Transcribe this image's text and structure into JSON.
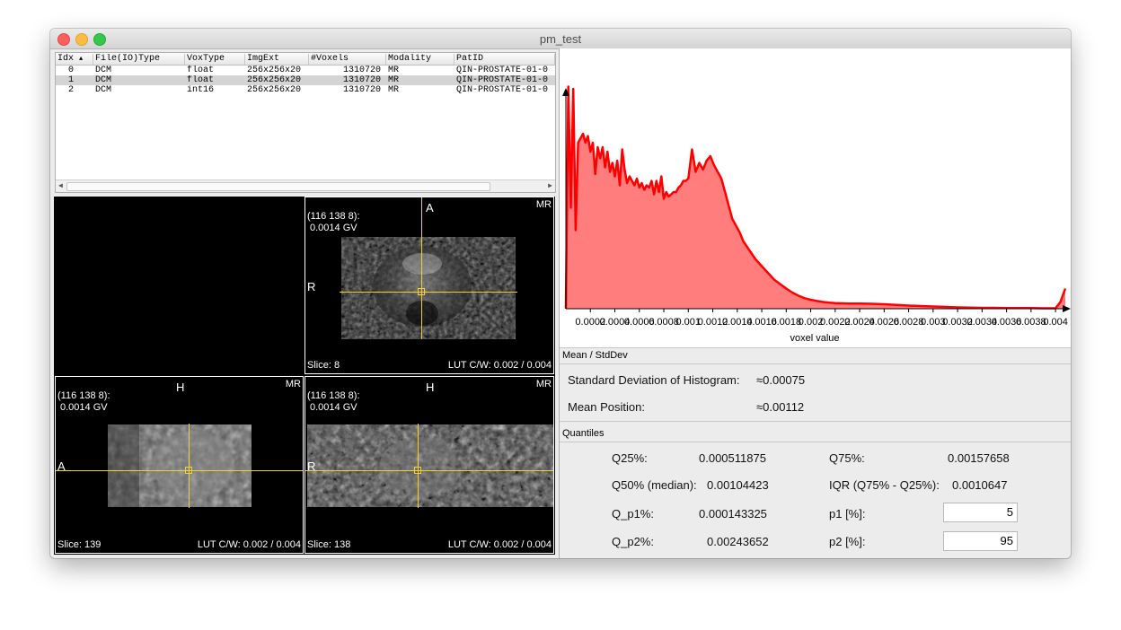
{
  "window": {
    "title": "pm_test"
  },
  "table": {
    "columns": [
      "Idx",
      "File(IO)Type",
      "VoxType",
      "ImgExt",
      "#Voxels",
      "Modality",
      "PatID"
    ],
    "rows": [
      [
        "0",
        "DCM",
        "float",
        "256x256x20",
        "1310720",
        "MR",
        "QIN-PROSTATE-01-0"
      ],
      [
        "1",
        "DCM",
        "float",
        "256x256x20",
        "1310720",
        "MR",
        "QIN-PROSTATE-01-0"
      ],
      [
        "2",
        "DCM",
        "int16",
        "256x256x20",
        "1310720",
        "MR",
        "QIN-PROSTATE-01-0"
      ]
    ],
    "selected_row": 1,
    "sort_indicator": "▲"
  },
  "viewers": {
    "axial": {
      "coords": "(116 138 8):",
      "value": "0.0014 GV",
      "top_label": "A",
      "left_label": "R",
      "modality": "MR",
      "slice": "Slice: 8",
      "lut": "LUT C/W: 0.002 / 0.004"
    },
    "sagittal": {
      "coords": "(116 138 8):",
      "value": "0.0014 GV",
      "top_label": "H",
      "left_label": "A",
      "modality": "MR",
      "slice": "Slice: 139",
      "lut": "LUT C/W: 0.002 / 0.004"
    },
    "coronal": {
      "coords": "(116 138 8):",
      "value": "0.0014 GV",
      "top_label": "H",
      "left_label": "R",
      "modality": "MR",
      "slice": "Slice: 138",
      "lut": "LUT C/W: 0.002 / 0.004"
    }
  },
  "chart_data": {
    "type": "area",
    "title": "",
    "xlabel": "voxel value",
    "ylabel": "",
    "xlim": [
      0,
      0.0041
    ],
    "tick_labels": [
      "0.0002",
      "0.0004",
      "0.0006",
      "0.0008",
      "0.001",
      "0.0012",
      "0.0014",
      "0.0016",
      "0.0018",
      "0.002",
      "0.0022",
      "0.0024",
      "0.0026",
      "0.0028",
      "0.003",
      "0.0032",
      "0.0034",
      "0.0036",
      "0.0038",
      "0.004"
    ],
    "tick_values": [
      0.0002,
      0.0004,
      0.0006,
      0.0008,
      0.001,
      0.0012,
      0.0014,
      0.0016,
      0.0018,
      0.002,
      0.0022,
      0.0024,
      0.0026,
      0.0028,
      0.003,
      0.0032,
      0.0034,
      0.0036,
      0.0038,
      0.004
    ],
    "x": [
      0,
      2e-05,
      4e-05,
      6e-05,
      8e-05,
      0.0001,
      0.00012,
      0.00014,
      0.00016,
      0.00018,
      0.0002,
      0.00022,
      0.00024,
      0.00026,
      0.00028,
      0.0003,
      0.00032,
      0.00034,
      0.00036,
      0.00038,
      0.0004,
      0.00042,
      0.00044,
      0.00046,
      0.00048,
      0.0005,
      0.00052,
      0.00054,
      0.00056,
      0.00058,
      0.0006,
      0.00062,
      0.00064,
      0.00066,
      0.00068,
      0.0007,
      0.00072,
      0.00074,
      0.00076,
      0.00078,
      0.0008,
      0.00082,
      0.00084,
      0.00086,
      0.00088,
      0.0009,
      0.00092,
      0.00094,
      0.00096,
      0.00098,
      0.001,
      0.00103,
      0.00106,
      0.00109,
      0.00112,
      0.00115,
      0.00118,
      0.00121,
      0.00124,
      0.00127,
      0.0013,
      0.00133,
      0.00136,
      0.00139,
      0.00142,
      0.00145,
      0.0015,
      0.00155,
      0.0016,
      0.00165,
      0.0017,
      0.00175,
      0.0018,
      0.00185,
      0.0019,
      0.00195,
      0.002,
      0.00205,
      0.0021,
      0.00215,
      0.0022,
      0.00225,
      0.0023,
      0.00235,
      0.0024,
      0.0025,
      0.0026,
      0.0027,
      0.0028,
      0.0029,
      0.003,
      0.0031,
      0.0032,
      0.0033,
      0.0034,
      0.0035,
      0.0036,
      0.0037,
      0.0038,
      0.0039,
      0.004,
      0.00404,
      0.00408
    ],
    "values": [
      0,
      0.99,
      0.45,
      0.98,
      0.35,
      0.74,
      0.76,
      0.78,
      0.74,
      0.77,
      0.7,
      0.74,
      0.6,
      0.72,
      0.67,
      0.72,
      0.63,
      0.7,
      0.61,
      0.65,
      0.59,
      0.66,
      0.55,
      0.71,
      0.62,
      0.56,
      0.59,
      0.57,
      0.55,
      0.58,
      0.54,
      0.56,
      0.53,
      0.55,
      0.54,
      0.57,
      0.51,
      0.57,
      0.52,
      0.59,
      0.49,
      0.52,
      0.5,
      0.51,
      0.52,
      0.52,
      0.54,
      0.55,
      0.57,
      0.57,
      0.58,
      0.71,
      0.61,
      0.65,
      0.62,
      0.66,
      0.68,
      0.64,
      0.61,
      0.58,
      0.52,
      0.46,
      0.4,
      0.37,
      0.34,
      0.3,
      0.26,
      0.22,
      0.19,
      0.16,
      0.13,
      0.11,
      0.09,
      0.072,
      0.058,
      0.047,
      0.04,
      0.035,
      0.03,
      0.027,
      0.025,
      0.024,
      0.023,
      0.023,
      0.023,
      0.022,
      0.02,
      0.017,
      0.014,
      0.012,
      0.01,
      0.008,
      0.006,
      0.005,
      0.004,
      0.004,
      0.003,
      0.003,
      0.003,
      0.002,
      0.002,
      0.03,
      0.09
    ],
    "color": "#ff3333",
    "fill": "#ff7d7d",
    "line_color": "#ff0000"
  },
  "meanstd": {
    "section_label": "Mean / StdDev",
    "std_label": "Standard Deviation of Histogram:",
    "std_value": "≈0.00075",
    "mean_label": "Mean Position:",
    "mean_value": "≈0.00112"
  },
  "quantiles": {
    "section_label": "Quantiles",
    "q25_label": "Q25%:",
    "q25_value": "0.000511875",
    "q75_label": "Q75%:",
    "q75_value": "0.00157658",
    "q50_label": "Q50% (median):",
    "q50_value": "0.00104423",
    "iqr_label": "IQR (Q75% - Q25%):",
    "iqr_value": "0.0010647",
    "qp1_label": "Q_p1%:",
    "qp1_value": "0.000143325",
    "p1_label": "p1 [%]:",
    "p1_value": "5",
    "qp2_label": "Q_p2%:",
    "qp2_value": "0.00243652",
    "p2_label": "p2 [%]:",
    "p2_value": "95"
  }
}
